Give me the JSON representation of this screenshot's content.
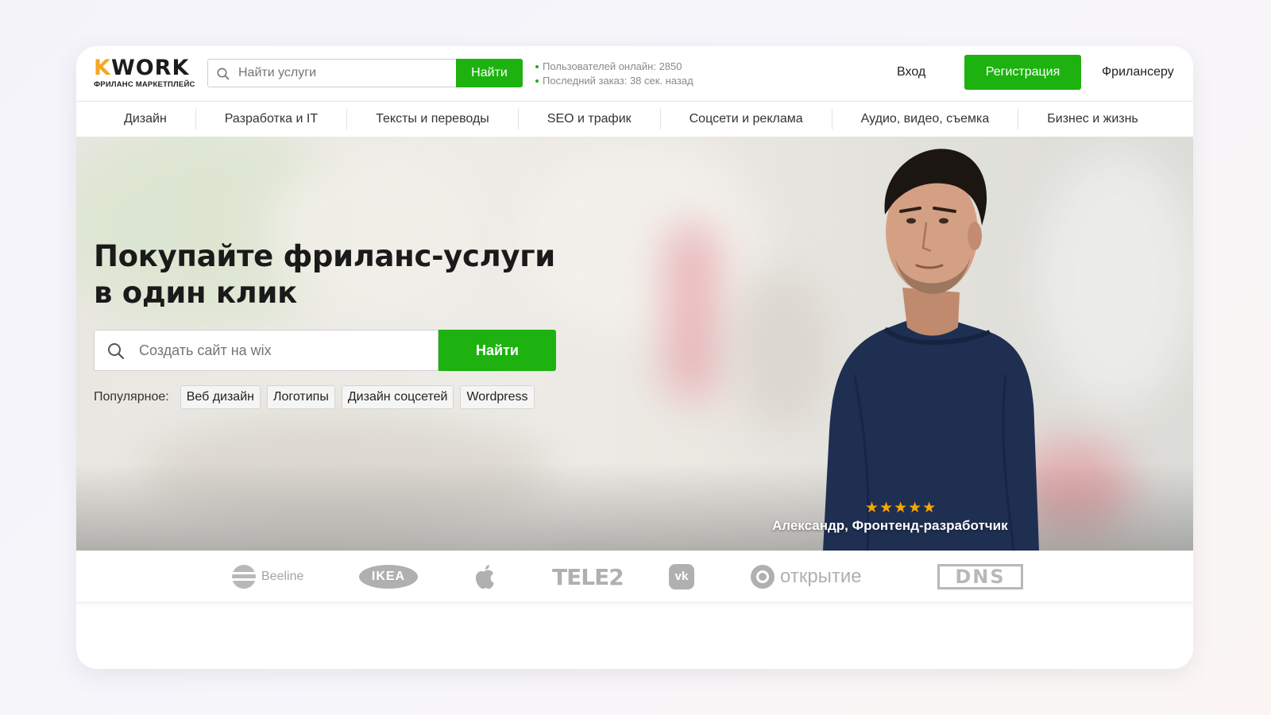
{
  "header": {
    "logo_main": "KWORK",
    "logo_sub": "ФРИЛАНС МАРКЕТПЛЕЙС",
    "search_placeholder": "Найти услуги",
    "search_button": "Найти",
    "stats": [
      "Пользователей онлайн: 2850",
      "Последний заказ: 38 сек. назад"
    ],
    "login": "Вход",
    "register": "Регистрация",
    "freelancer": "Фрилансеру"
  },
  "categories": [
    "Дизайн",
    "Разработка и IT",
    "Тексты и переводы",
    "SEO и трафик",
    "Соцсети и реклама",
    "Аудио, видео, съемка",
    "Бизнес и жизнь"
  ],
  "hero": {
    "title_line1": "Покупайте фриланс-услуги",
    "title_line2": "в один клик",
    "search_placeholder": "Создать сайт на wix",
    "search_button": "Найти",
    "popular_label": "Популярное:",
    "popular_tags": [
      "Веб дизайн",
      "Логотипы",
      "Дизайн соцсетей",
      "Wordpress"
    ],
    "rating_stars": 5,
    "person_caption": "Александр, Фронтенд-разработчик"
  },
  "logos": [
    "Beeline",
    "IKEA",
    "apple",
    "TELE2",
    "vk",
    "открытие",
    "DNS"
  ],
  "colors": {
    "accent_green": "#1db20f",
    "star": "#f7a600",
    "logo_gray": "#a9a9a9"
  }
}
